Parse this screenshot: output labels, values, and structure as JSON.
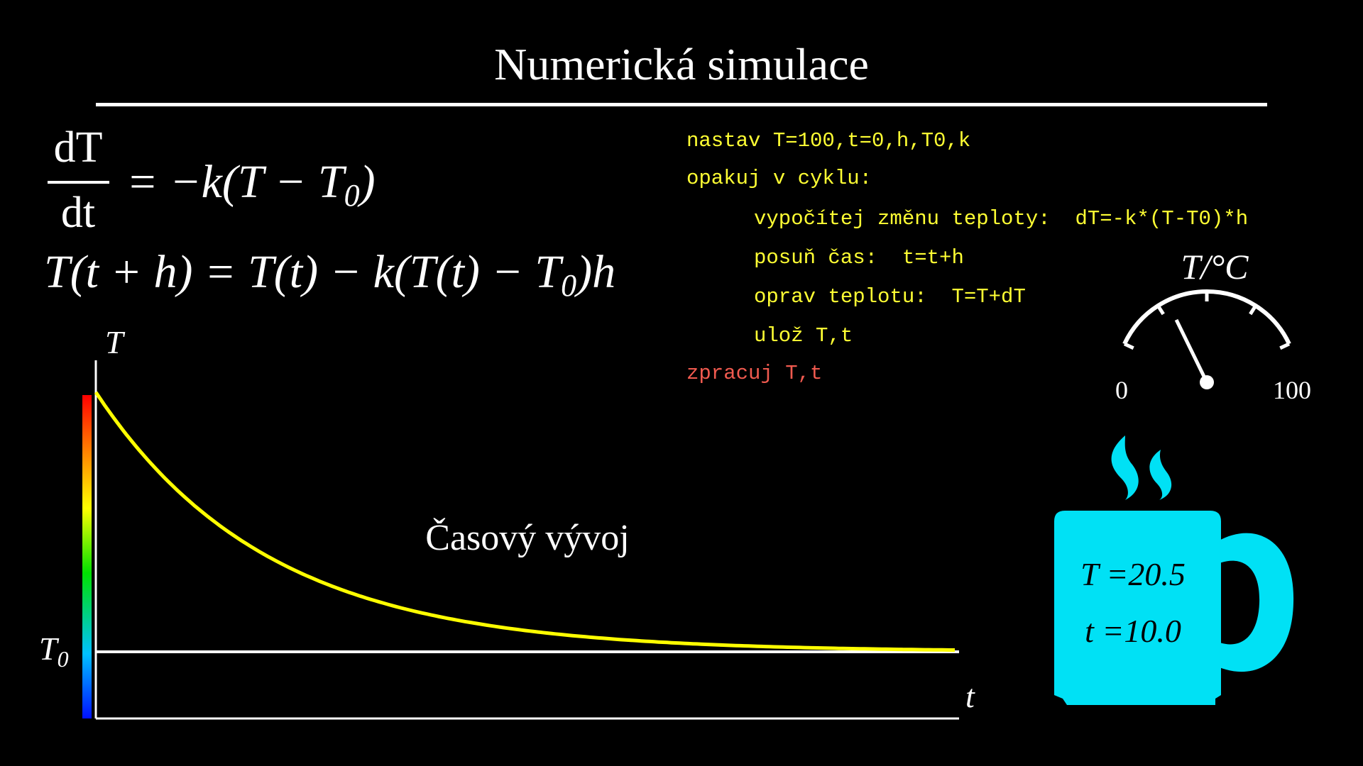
{
  "title": "Numerická simulace",
  "equations": {
    "ode_num": "dT",
    "ode_den": "dt",
    "ode_rhs_prefix": "= −k(T − T",
    "ode_rhs_sub": "0",
    "ode_rhs_suffix": ")",
    "euler_prefix": "T(t + h) = T(t) − k(T(t) − T",
    "euler_sub": "0",
    "euler_suffix": ")h"
  },
  "pseudocode": {
    "lines": [
      "nastav T=100,t=0,h,T0,k",
      "opakuj v cyklu:",
      "vypočítej změnu teploty:  dT=-k*(T-T0)*h",
      "posuň čas:  t=t+h",
      "oprav teplotu:  T=T+dT",
      "ulož T,t",
      "zpracuj T,t"
    ],
    "color_main": "#ffff33",
    "color_last": "#f05a4f"
  },
  "plot": {
    "y_label": "T",
    "x_label": "t",
    "t0_label": "T",
    "t0_sub": "0",
    "annotation": "Časový vývoj",
    "curve_color": "#ffff00",
    "T_initial": 100,
    "T_ambient": 20,
    "k": 0.5,
    "t_max": 10
  },
  "gauge": {
    "label": "T/°C",
    "min_label": "0",
    "max_label": "100",
    "value_fraction": 0.3
  },
  "mug": {
    "color": "#00e1f5",
    "temperature_text": "T =20.5",
    "time_text": "t =10.0"
  }
}
